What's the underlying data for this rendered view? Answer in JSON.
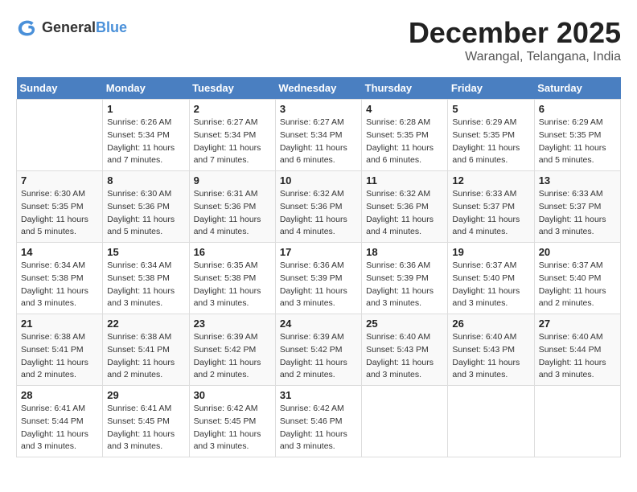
{
  "header": {
    "logo_general": "General",
    "logo_blue": "Blue",
    "month_title": "December 2025",
    "location": "Warangal, Telangana, India"
  },
  "days_of_week": [
    "Sunday",
    "Monday",
    "Tuesday",
    "Wednesday",
    "Thursday",
    "Friday",
    "Saturday"
  ],
  "weeks": [
    [
      {
        "day": "",
        "sunrise": "",
        "sunset": "",
        "daylight": ""
      },
      {
        "day": "1",
        "sunrise": "Sunrise: 6:26 AM",
        "sunset": "Sunset: 5:34 PM",
        "daylight": "Daylight: 11 hours and 7 minutes."
      },
      {
        "day": "2",
        "sunrise": "Sunrise: 6:27 AM",
        "sunset": "Sunset: 5:34 PM",
        "daylight": "Daylight: 11 hours and 7 minutes."
      },
      {
        "day": "3",
        "sunrise": "Sunrise: 6:27 AM",
        "sunset": "Sunset: 5:34 PM",
        "daylight": "Daylight: 11 hours and 6 minutes."
      },
      {
        "day": "4",
        "sunrise": "Sunrise: 6:28 AM",
        "sunset": "Sunset: 5:35 PM",
        "daylight": "Daylight: 11 hours and 6 minutes."
      },
      {
        "day": "5",
        "sunrise": "Sunrise: 6:29 AM",
        "sunset": "Sunset: 5:35 PM",
        "daylight": "Daylight: 11 hours and 6 minutes."
      },
      {
        "day": "6",
        "sunrise": "Sunrise: 6:29 AM",
        "sunset": "Sunset: 5:35 PM",
        "daylight": "Daylight: 11 hours and 5 minutes."
      }
    ],
    [
      {
        "day": "7",
        "sunrise": "Sunrise: 6:30 AM",
        "sunset": "Sunset: 5:35 PM",
        "daylight": "Daylight: 11 hours and 5 minutes."
      },
      {
        "day": "8",
        "sunrise": "Sunrise: 6:30 AM",
        "sunset": "Sunset: 5:36 PM",
        "daylight": "Daylight: 11 hours and 5 minutes."
      },
      {
        "day": "9",
        "sunrise": "Sunrise: 6:31 AM",
        "sunset": "Sunset: 5:36 PM",
        "daylight": "Daylight: 11 hours and 4 minutes."
      },
      {
        "day": "10",
        "sunrise": "Sunrise: 6:32 AM",
        "sunset": "Sunset: 5:36 PM",
        "daylight": "Daylight: 11 hours and 4 minutes."
      },
      {
        "day": "11",
        "sunrise": "Sunrise: 6:32 AM",
        "sunset": "Sunset: 5:36 PM",
        "daylight": "Daylight: 11 hours and 4 minutes."
      },
      {
        "day": "12",
        "sunrise": "Sunrise: 6:33 AM",
        "sunset": "Sunset: 5:37 PM",
        "daylight": "Daylight: 11 hours and 4 minutes."
      },
      {
        "day": "13",
        "sunrise": "Sunrise: 6:33 AM",
        "sunset": "Sunset: 5:37 PM",
        "daylight": "Daylight: 11 hours and 3 minutes."
      }
    ],
    [
      {
        "day": "14",
        "sunrise": "Sunrise: 6:34 AM",
        "sunset": "Sunset: 5:38 PM",
        "daylight": "Daylight: 11 hours and 3 minutes."
      },
      {
        "day": "15",
        "sunrise": "Sunrise: 6:34 AM",
        "sunset": "Sunset: 5:38 PM",
        "daylight": "Daylight: 11 hours and 3 minutes."
      },
      {
        "day": "16",
        "sunrise": "Sunrise: 6:35 AM",
        "sunset": "Sunset: 5:38 PM",
        "daylight": "Daylight: 11 hours and 3 minutes."
      },
      {
        "day": "17",
        "sunrise": "Sunrise: 6:36 AM",
        "sunset": "Sunset: 5:39 PM",
        "daylight": "Daylight: 11 hours and 3 minutes."
      },
      {
        "day": "18",
        "sunrise": "Sunrise: 6:36 AM",
        "sunset": "Sunset: 5:39 PM",
        "daylight": "Daylight: 11 hours and 3 minutes."
      },
      {
        "day": "19",
        "sunrise": "Sunrise: 6:37 AM",
        "sunset": "Sunset: 5:40 PM",
        "daylight": "Daylight: 11 hours and 3 minutes."
      },
      {
        "day": "20",
        "sunrise": "Sunrise: 6:37 AM",
        "sunset": "Sunset: 5:40 PM",
        "daylight": "Daylight: 11 hours and 2 minutes."
      }
    ],
    [
      {
        "day": "21",
        "sunrise": "Sunrise: 6:38 AM",
        "sunset": "Sunset: 5:41 PM",
        "daylight": "Daylight: 11 hours and 2 minutes."
      },
      {
        "day": "22",
        "sunrise": "Sunrise: 6:38 AM",
        "sunset": "Sunset: 5:41 PM",
        "daylight": "Daylight: 11 hours and 2 minutes."
      },
      {
        "day": "23",
        "sunrise": "Sunrise: 6:39 AM",
        "sunset": "Sunset: 5:42 PM",
        "daylight": "Daylight: 11 hours and 2 minutes."
      },
      {
        "day": "24",
        "sunrise": "Sunrise: 6:39 AM",
        "sunset": "Sunset: 5:42 PM",
        "daylight": "Daylight: 11 hours and 2 minutes."
      },
      {
        "day": "25",
        "sunrise": "Sunrise: 6:40 AM",
        "sunset": "Sunset: 5:43 PM",
        "daylight": "Daylight: 11 hours and 3 minutes."
      },
      {
        "day": "26",
        "sunrise": "Sunrise: 6:40 AM",
        "sunset": "Sunset: 5:43 PM",
        "daylight": "Daylight: 11 hours and 3 minutes."
      },
      {
        "day": "27",
        "sunrise": "Sunrise: 6:40 AM",
        "sunset": "Sunset: 5:44 PM",
        "daylight": "Daylight: 11 hours and 3 minutes."
      }
    ],
    [
      {
        "day": "28",
        "sunrise": "Sunrise: 6:41 AM",
        "sunset": "Sunset: 5:44 PM",
        "daylight": "Daylight: 11 hours and 3 minutes."
      },
      {
        "day": "29",
        "sunrise": "Sunrise: 6:41 AM",
        "sunset": "Sunset: 5:45 PM",
        "daylight": "Daylight: 11 hours and 3 minutes."
      },
      {
        "day": "30",
        "sunrise": "Sunrise: 6:42 AM",
        "sunset": "Sunset: 5:45 PM",
        "daylight": "Daylight: 11 hours and 3 minutes."
      },
      {
        "day": "31",
        "sunrise": "Sunrise: 6:42 AM",
        "sunset": "Sunset: 5:46 PM",
        "daylight": "Daylight: 11 hours and 3 minutes."
      },
      {
        "day": "",
        "sunrise": "",
        "sunset": "",
        "daylight": ""
      },
      {
        "day": "",
        "sunrise": "",
        "sunset": "",
        "daylight": ""
      },
      {
        "day": "",
        "sunrise": "",
        "sunset": "",
        "daylight": ""
      }
    ]
  ]
}
